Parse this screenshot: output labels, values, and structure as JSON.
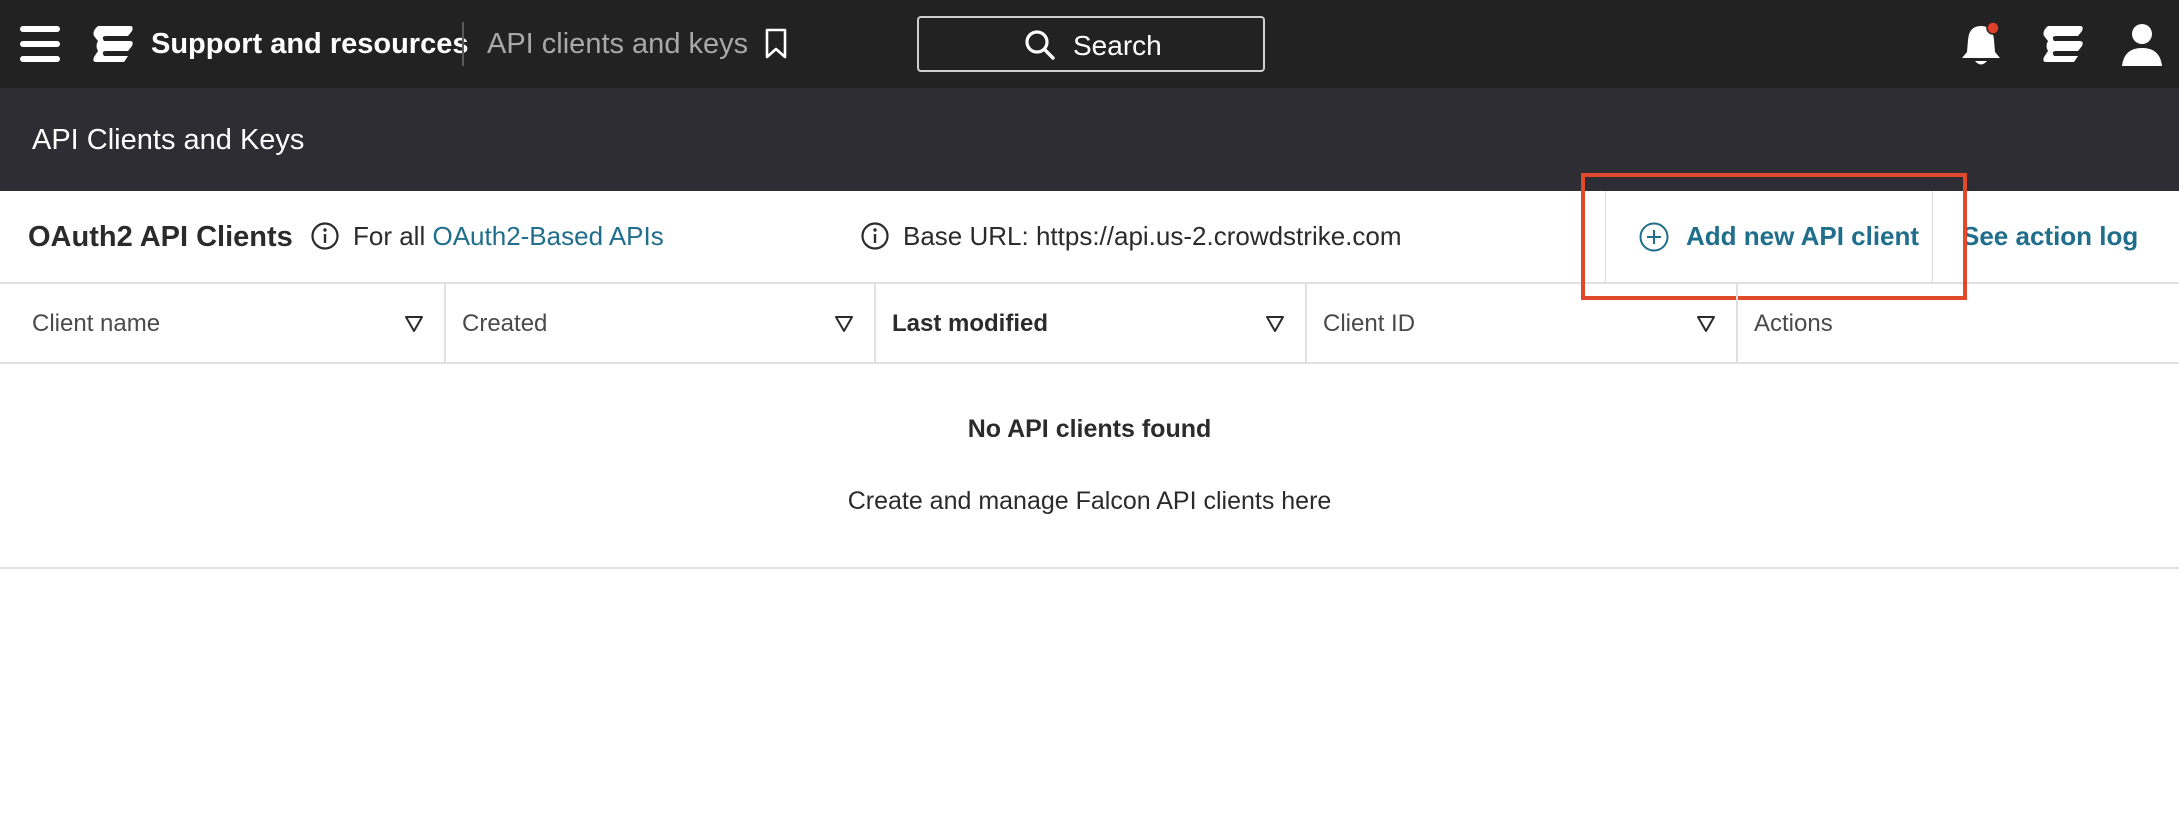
{
  "topbar": {
    "app_title": "Support and resources",
    "page_crumb": "API clients and keys",
    "search_label": "Search",
    "notification_color": "#e0402a"
  },
  "header": {
    "title": "API Clients and Keys"
  },
  "toolbar": {
    "section_title": "OAuth2 API Clients",
    "for_all_prefix": "For all",
    "for_all_link": "OAuth2-Based APIs",
    "base_url": "Base URL: https://api.us-2.crowdstrike.com",
    "add_button_label": "Add new API client",
    "action_log_label": "See action log"
  },
  "table": {
    "columns": [
      {
        "label": "Client name"
      },
      {
        "label": "Created"
      },
      {
        "label": "Last modified"
      },
      {
        "label": "Client ID"
      },
      {
        "label": "Actions"
      }
    ]
  },
  "empty_state": {
    "title": "No API clients found",
    "subtitle": "Create and manage Falcon API clients here"
  },
  "colors": {
    "topbar_bg": "#222222",
    "header_bg": "#2d2d33",
    "link": "#1f6e8c",
    "highlight": "#e04a2a"
  },
  "icons": [
    "hamburger-menu-icon",
    "falcon-logo-icon",
    "bookmark-icon",
    "search-icon",
    "bell-icon",
    "user-icon",
    "info-icon",
    "plus-circle-icon",
    "filter-triangle-icon"
  ]
}
